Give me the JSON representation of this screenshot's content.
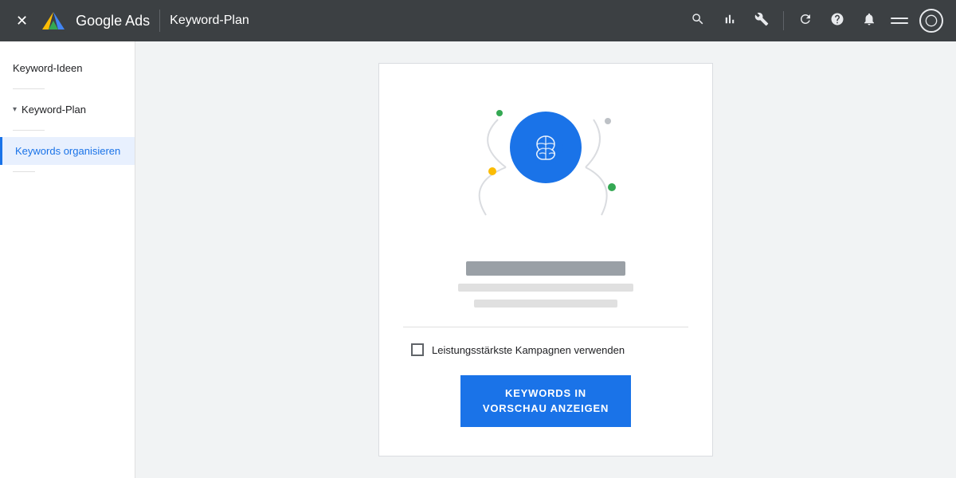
{
  "topbar": {
    "close_label": "✕",
    "app_title": "Google Ads",
    "page_title": "Keyword-Plan",
    "icons": {
      "search": "🔍",
      "chart": "▦",
      "tool": "🔧",
      "refresh": "↻",
      "help": "?",
      "bell": "🔔"
    }
  },
  "sidebar": {
    "item1_label": "Keyword-Ideen",
    "item2_label": "Keyword-Plan",
    "item3_label": "Keywords organisieren"
  },
  "card": {
    "bar_main_label": "",
    "bar_sub1_label": "",
    "bar_sub2_label": "",
    "checkbox_label": "Leistungsstärkste Kampagnen verwenden",
    "cta_line1": "KEYWORDS IN",
    "cta_line2": "VORSCHAU ANZEIGEN",
    "cta_label": "KEYWORDS IN\nVORSCHAU ANZEIGEN"
  }
}
